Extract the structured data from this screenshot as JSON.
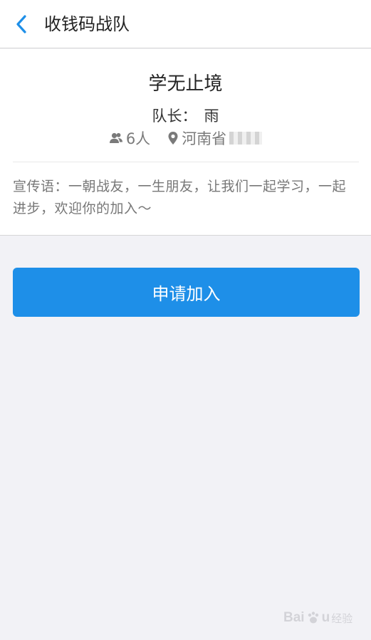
{
  "header": {
    "back_icon": "chevron-left-icon",
    "title": "收钱码战队"
  },
  "team": {
    "name": "学无止境",
    "captain_label": "队长：",
    "captain_name": "雨",
    "member_icon": "people-icon",
    "member_count": "6人",
    "location_icon": "map-pin-icon",
    "location": "河南省",
    "slogan": "宣传语：一朝战友，一生朋友，让我们一起学习，一起进步，欢迎你的加入～"
  },
  "actions": {
    "join_label": "申请加入"
  },
  "colors": {
    "accent": "#1e8fe8",
    "background": "#f2f2f6",
    "card": "#ffffff",
    "muted_text": "#7a7a7a"
  }
}
